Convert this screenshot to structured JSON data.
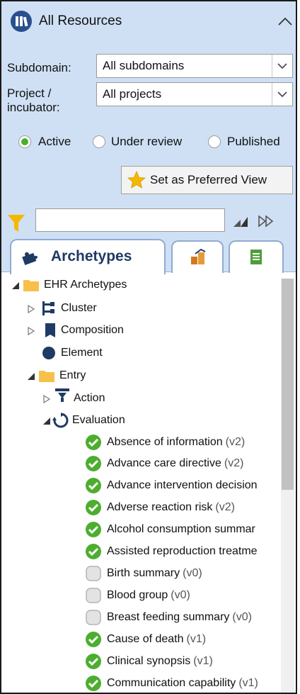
{
  "header": {
    "title": "All Resources"
  },
  "filters": {
    "subdomain_label": "Subdomain:",
    "subdomain_value": "All subdomains",
    "project_label_1": "Project /",
    "project_label_2": "incubator:",
    "project_value": "All projects"
  },
  "status": {
    "options": [
      "Active",
      "Under review",
      "Published"
    ],
    "selected": "Active"
  },
  "preferred_button": "Set as Preferred View",
  "search": {
    "value": ""
  },
  "tabs": [
    {
      "label": "Archetypes",
      "active": true
    },
    {
      "label": "",
      "icon": "templates-icon"
    },
    {
      "label": "",
      "icon": "document-icon"
    }
  ],
  "tree": {
    "root": "EHR Archetypes",
    "cluster": "Cluster",
    "composition": "Composition",
    "element": "Element",
    "entry": "Entry",
    "action": "Action",
    "evaluation": "Evaluation",
    "items": [
      {
        "name": "Absence of information",
        "version": "(v2)",
        "status": "published"
      },
      {
        "name": "Advance care directive",
        "version": "(v2)",
        "status": "published"
      },
      {
        "name": "Advance intervention decision",
        "version": "",
        "status": "published"
      },
      {
        "name": "Adverse reaction risk",
        "version": "(v2)",
        "status": "published"
      },
      {
        "name": "Alcohol consumption summar",
        "version": "",
        "status": "published"
      },
      {
        "name": "Assisted reproduction treatme",
        "version": "",
        "status": "published"
      },
      {
        "name": "Birth summary",
        "version": "(v0)",
        "status": "draft"
      },
      {
        "name": "Blood group",
        "version": "(v0)",
        "status": "draft"
      },
      {
        "name": "Breast feeding summary",
        "version": "(v0)",
        "status": "draft"
      },
      {
        "name": "Cause of death",
        "version": "(v1)",
        "status": "published"
      },
      {
        "name": "Clinical synopsis",
        "version": "(v1)",
        "status": "published"
      },
      {
        "name": "Communication capability",
        "version": "(v1)",
        "status": "published"
      }
    ]
  },
  "colors": {
    "panel_bg": "#cfe0f5",
    "published": "#4cae2f",
    "draft": "#c8c8c8",
    "folder": "#f6c04a",
    "navy": "#1f3a64"
  }
}
